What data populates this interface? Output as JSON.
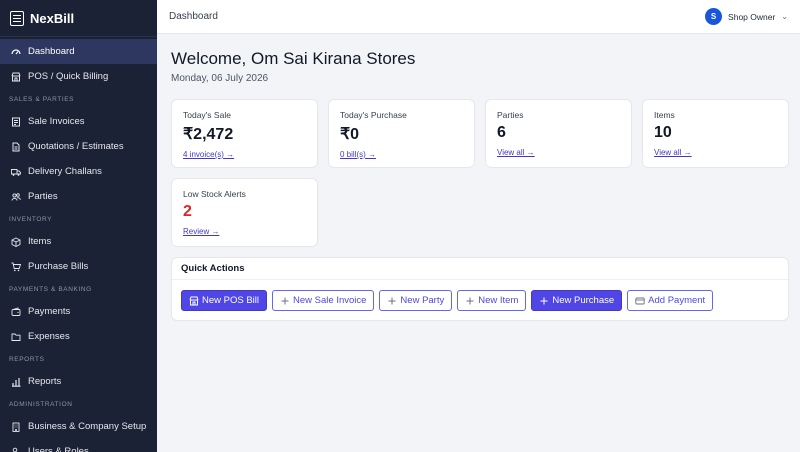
{
  "brand": {
    "name": "NexBill"
  },
  "sidebar": {
    "items": [
      {
        "label": "Dashboard",
        "icon": "dashboard-icon",
        "active": true
      },
      {
        "label": "POS / Quick Billing",
        "icon": "store-icon"
      }
    ],
    "sections": [
      {
        "title": "SALES & PARTIES",
        "items": [
          {
            "label": "Sale Invoices",
            "icon": "invoice-icon"
          },
          {
            "label": "Quotations / Estimates",
            "icon": "document-icon"
          },
          {
            "label": "Delivery Challans",
            "icon": "truck-icon"
          },
          {
            "label": "Parties",
            "icon": "users-icon"
          }
        ]
      },
      {
        "title": "INVENTORY",
        "items": [
          {
            "label": "Items",
            "icon": "box-icon"
          },
          {
            "label": "Purchase Bills",
            "icon": "cart-icon"
          }
        ]
      },
      {
        "title": "PAYMENTS & BANKING",
        "items": [
          {
            "label": "Payments",
            "icon": "wallet-icon"
          },
          {
            "label": "Expenses",
            "icon": "folder-icon"
          }
        ]
      },
      {
        "title": "REPORTS",
        "items": [
          {
            "label": "Reports",
            "icon": "bar-chart-icon"
          }
        ]
      },
      {
        "title": "ADMINISTRATION",
        "items": [
          {
            "label": "Business & Company Setup",
            "icon": "building-icon"
          },
          {
            "label": "Users & Roles",
            "icon": "user-cog-icon"
          }
        ]
      }
    ]
  },
  "topbar": {
    "breadcrumb": "Dashboard",
    "user_initial": "S",
    "user_name": "Shop Owner"
  },
  "main": {
    "welcome": "Welcome, Om Sai Kirana Stores",
    "date": "Monday, 06 July 2026",
    "cards": [
      {
        "label": "Today's Sale",
        "value": "₹2,472",
        "link": "4 invoice(s) →"
      },
      {
        "label": "Today's Purchase",
        "value": "₹0",
        "link": "0 bill(s) →"
      },
      {
        "label": "Parties",
        "value": "6",
        "link": "View all →"
      },
      {
        "label": "Items",
        "value": "10",
        "link": "View all →"
      },
      {
        "label": "Low Stock Alerts",
        "value": "2",
        "link": "Review →",
        "alert": true
      }
    ],
    "quick_actions": {
      "title": "Quick Actions",
      "buttons": [
        {
          "label": "New POS Bill",
          "style": "primary",
          "icon": "store-icon"
        },
        {
          "label": "New Sale Invoice",
          "style": "outline",
          "icon": "plus-icon"
        },
        {
          "label": "New Party",
          "style": "outline",
          "icon": "plus-icon"
        },
        {
          "label": "New Item",
          "style": "outline",
          "icon": "plus-icon"
        },
        {
          "label": "New Purchase",
          "style": "primary",
          "icon": "plus-icon"
        },
        {
          "label": "Add Payment",
          "style": "outline",
          "icon": "payment-icon"
        }
      ]
    }
  },
  "colors": {
    "sidebar_bg": "#1b2236",
    "accent": "#4f46e5",
    "alert": "#dc2626",
    "avatar": "#1a56db"
  }
}
